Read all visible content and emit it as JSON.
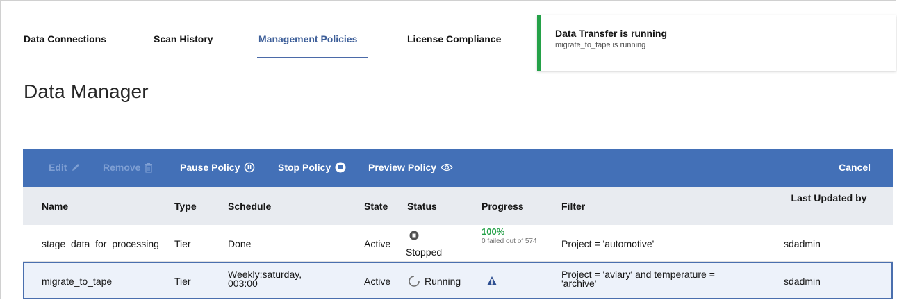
{
  "tabs": [
    {
      "label": "Data Connections"
    },
    {
      "label": "Scan History"
    },
    {
      "label": "Management Policies",
      "active": true
    },
    {
      "label": "License Compliance"
    }
  ],
  "notification": {
    "title": "Data Transfer is running",
    "subtitle": "migrate_to_tape is running",
    "accent_color": "#24a148"
  },
  "page_title": "Data Manager",
  "toolbar": {
    "edit_label": "Edit",
    "remove_label": "Remove",
    "pause_label": "Pause Policy",
    "stop_label": "Stop Policy",
    "preview_label": "Preview Policy",
    "cancel_label": "Cancel",
    "background_color": "#4370b7"
  },
  "table": {
    "headers": {
      "name": "Name",
      "type": "Type",
      "schedule": "Schedule",
      "state": "State",
      "status": "Status",
      "progress": "Progress",
      "filter": "Filter",
      "last_updated_by": "Last Updated by"
    },
    "rows": [
      {
        "name": "stage_data_for_processing",
        "type": "Tier",
        "schedule": "Done",
        "state": "Active",
        "status": "Stopped",
        "status_icon": "stopped-icon",
        "progress_pct": "100%",
        "progress_detail": "0 failed out of 574",
        "filter": "Project = 'automotive'",
        "last_updated_by": "sdadmin"
      },
      {
        "name": "migrate_to_tape",
        "type": "Tier",
        "schedule": "Weekly:saturday, 003:00",
        "state": "Active",
        "status": "Running",
        "status_icon": "spinner-icon",
        "progress_icon": "warning-icon",
        "filter": "Project = 'aviary' and temperature = 'archive'",
        "last_updated_by": "sdadmin",
        "selected": true
      }
    ]
  }
}
